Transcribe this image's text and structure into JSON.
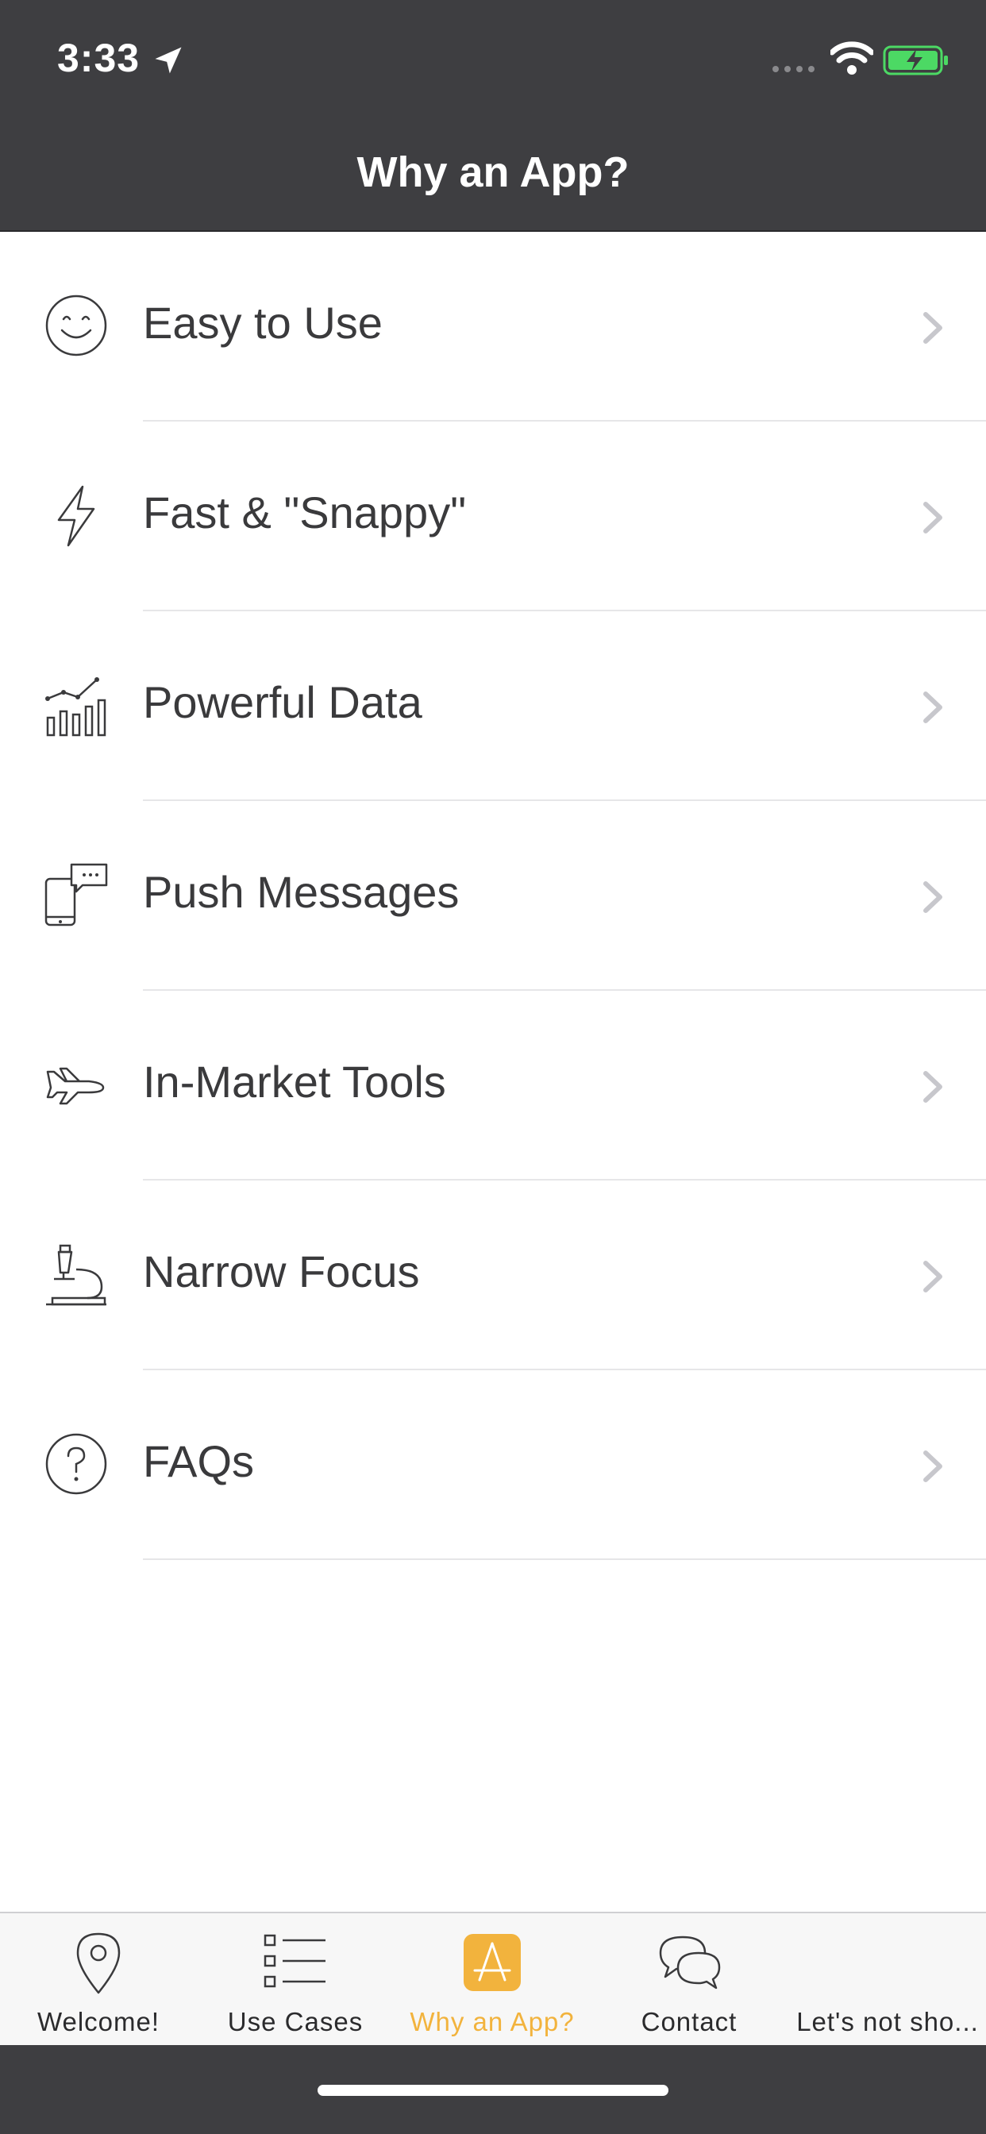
{
  "status_bar": {
    "time": "3:33",
    "icons": [
      "location-arrow-icon",
      "signal-icon",
      "wifi-icon",
      "battery-charging-icon"
    ],
    "battery_color": "#4cd964"
  },
  "header": {
    "title": "Why an App?",
    "background": "#3e3e41"
  },
  "list": {
    "items": [
      {
        "label": "Easy to Use",
        "icon": "smiley-icon"
      },
      {
        "label": "Fast & \"Snappy\"",
        "icon": "lightning-icon"
      },
      {
        "label": "Powerful Data",
        "icon": "bar-chart-icon"
      },
      {
        "label": "Push Messages",
        "icon": "phone-message-icon"
      },
      {
        "label": "In-Market Tools",
        "icon": "airplane-icon"
      },
      {
        "label": "Narrow Focus",
        "icon": "microscope-icon"
      },
      {
        "label": "FAQs",
        "icon": "question-circle-icon"
      }
    ]
  },
  "tabbar": {
    "accent": "#f2b33d",
    "active_index": 2,
    "tabs": [
      {
        "label": "Welcome!",
        "icon": "location-pin-icon"
      },
      {
        "label": "Use Cases",
        "icon": "list-icon"
      },
      {
        "label": "Why an App?",
        "icon": "app-store-icon"
      },
      {
        "label": "Contact",
        "icon": "chat-bubbles-icon"
      },
      {
        "label": "Let's not sho...",
        "icon": ""
      }
    ]
  }
}
